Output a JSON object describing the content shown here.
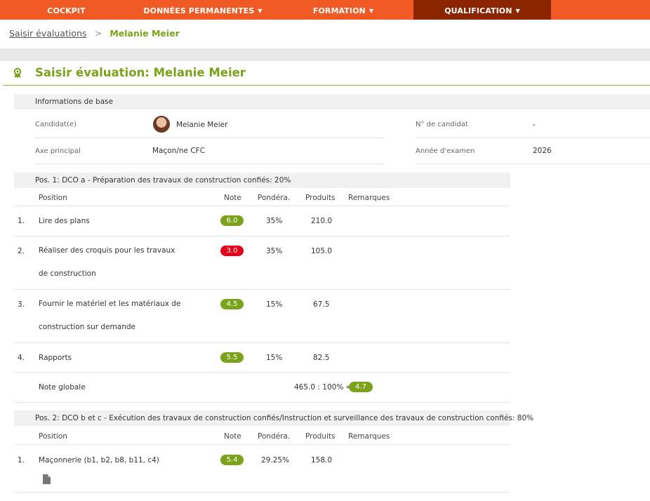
{
  "nav": {
    "items": [
      {
        "label": "COCKPIT",
        "caret": ""
      },
      {
        "label": "DONNÉES PERMANENTES",
        "caret": "▼"
      },
      {
        "label": "FORMATION",
        "caret": "▼"
      },
      {
        "label": "QUALIFICATION",
        "caret": "▼"
      }
    ],
    "accent": "#f15a24",
    "active_color": "#8b2500"
  },
  "breadcrumb": {
    "link": "Saisir évaluations",
    "separator": ">",
    "current": "Melanie Meier"
  },
  "page_title": "Saisir évaluation: Melanie Meier",
  "title_icon": "award-icon",
  "base_info": {
    "heading": "Informations de base",
    "candidate_label": "Candidat(e)",
    "candidate_name": "Melanie Meier",
    "candidate_no_label": "N° de candidat",
    "candidate_no": "-",
    "axis_label": "Axe principal",
    "axis_value": "Maçon/ne CFC",
    "year_label": "Année d'examen",
    "year_value": "2026"
  },
  "headers": {
    "position": "Position",
    "note": "Note",
    "weight": "Pondéra.",
    "products": "Produits",
    "remarks": "Remarques"
  },
  "pos1": {
    "heading": "Pos. 1: DCO a - Préparation des travaux de construction confiés: 20%",
    "rows": [
      {
        "num": "1.",
        "position": "Lire des plans",
        "note": "6.0",
        "weight": "35%",
        "product": "210.0"
      },
      {
        "num": "2.",
        "position": "Réaliser des croquis pour les travaux de construction",
        "note": "3.0",
        "weight": "35%",
        "product": "105.0"
      },
      {
        "num": "3.",
        "position": "Fournir le matériel et les matériaux de construction sur demande",
        "note": "4.5",
        "weight": "15%",
        "product": "67.5"
      },
      {
        "num": "4.",
        "position": "Rapports",
        "note": "5.5",
        "weight": "15%",
        "product": "82.5"
      }
    ],
    "total_label": "Note globale",
    "total_formula": "465.0 : 100% =",
    "total_note": "4.7"
  },
  "pos2": {
    "heading": "Pos. 2: DCO b et c - Exécution des travaux de construction confiés/Instruction et surveillance des travaux de construction confiés: 80%",
    "rows": [
      {
        "num": "1.",
        "position": "Maçonnerie (b1, b2, b8, b11, c4)",
        "note": "5.4",
        "weight": "29.25%",
        "product": "158.0"
      }
    ]
  },
  "colors": {
    "good": "#7aa21a",
    "bad": "#e3001b",
    "title": "#7aa21a"
  }
}
